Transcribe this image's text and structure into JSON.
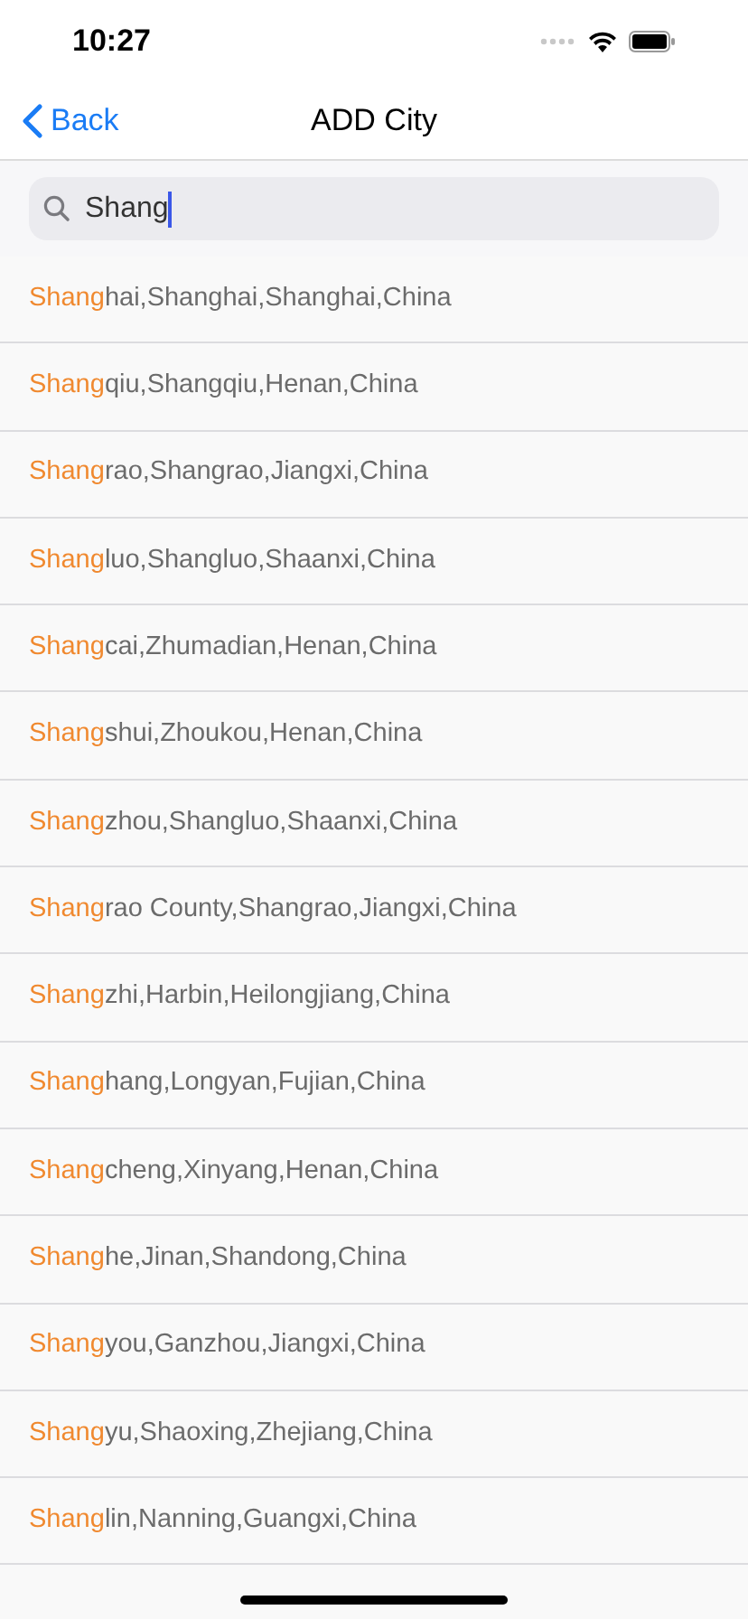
{
  "status_bar": {
    "time": "10:27"
  },
  "nav": {
    "back": "Back",
    "title": "ADD City"
  },
  "search": {
    "value": "Shang"
  },
  "results": [
    {
      "match": "Shang",
      "rest": "hai,Shanghai,Shanghai,China"
    },
    {
      "match": "Shang",
      "rest": "qiu,Shangqiu,Henan,China"
    },
    {
      "match": "Shang",
      "rest": "rao,Shangrao,Jiangxi,China"
    },
    {
      "match": "Shang",
      "rest": "luo,Shangluo,Shaanxi,China"
    },
    {
      "match": "Shang",
      "rest": "cai,Zhumadian,Henan,China"
    },
    {
      "match": "Shang",
      "rest": "shui,Zhoukou,Henan,China"
    },
    {
      "match": "Shang",
      "rest": "zhou,Shangluo,Shaanxi,China"
    },
    {
      "match": "Shang",
      "rest": "rao County,Shangrao,Jiangxi,China"
    },
    {
      "match": "Shang",
      "rest": "zhi,Harbin,Heilongjiang,China"
    },
    {
      "match": "Shang",
      "rest": "hang,Longyan,Fujian,China"
    },
    {
      "match": "Shang",
      "rest": "cheng,Xinyang,Henan,China"
    },
    {
      "match": "Shang",
      "rest": "he,Jinan,Shandong,China"
    },
    {
      "match": "Shang",
      "rest": "you,Ganzhou,Jiangxi,China"
    },
    {
      "match": "Shang",
      "rest": "yu,Shaoxing,Zhejiang,China"
    },
    {
      "match": "Shang",
      "rest": "lin,Nanning,Guangxi,China"
    }
  ]
}
